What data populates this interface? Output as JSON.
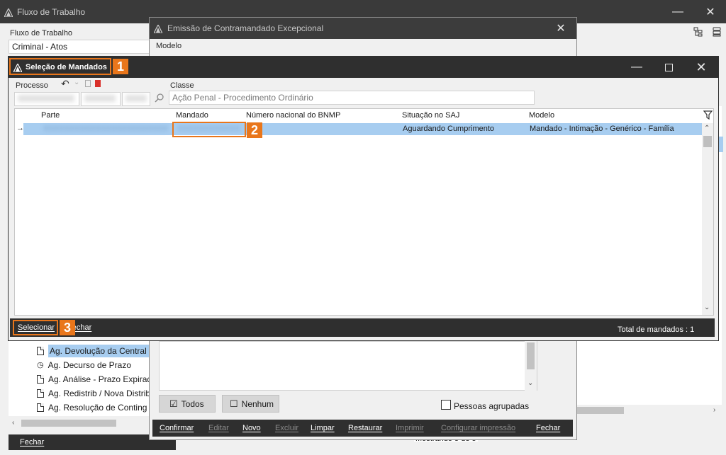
{
  "bg_window": {
    "title": "Fluxo de Trabalho",
    "fluxo_label": "Fluxo de Trabalho",
    "fluxo_value": "Criminal - Atos",
    "tree_items": [
      "Ag. Devolução da Central (",
      "Ag. Decurso de Prazo",
      "Ag. Análise - Prazo Expirad",
      "Ag. Redistrib / Nova Distrib",
      "Ag. Resolução de Conting"
    ],
    "fechar_label": "Fechar",
    "mostrando": "Mostrando 5 de 5"
  },
  "mid_window": {
    "title": "Emissão de Contramandado Excepcional",
    "modelo_label": "Modelo",
    "todos_label": "Todos",
    "nenhum_label": "Nenhum",
    "pessoas_label": "Pessoas agrupadas",
    "footer": {
      "confirmar": "Confirmar",
      "editar": "Editar",
      "novo": "Novo",
      "excluir": "Excluir",
      "limpar": "Limpar",
      "restaurar": "Restaurar",
      "imprimir": "Imprimir",
      "configurar": "Configurar impressão",
      "fechar": "Fechar"
    }
  },
  "dialog": {
    "title": "Seleção de Mandados",
    "processo_label": "Processo",
    "classe_label": "Classe",
    "classe_value": "Ação Penal - Procedimento Ordinário",
    "columns": [
      "Parte",
      "Mandado",
      "Número nacional do BNMP",
      "Situação no SAJ",
      "Modelo"
    ],
    "row": {
      "parte": "XXXXXXXXXXXXXXXXXXXXXXXX",
      "mandado": "XXXXXXXXXXXXXX",
      "bnmp": "",
      "situacao": "Aguardando Cumprimento",
      "modelo": "Mandado - Intimação - Genérico - Família"
    },
    "selecionar_label": "Selecionar",
    "fechar_label": "Fechar",
    "total_label": "Total de mandados : 1"
  },
  "callouts": [
    "1",
    "2",
    "3"
  ],
  "colors": {
    "accent": "#e9761b",
    "selected_row": "#a7cdf0",
    "dark_bar": "#2f2f2f"
  }
}
